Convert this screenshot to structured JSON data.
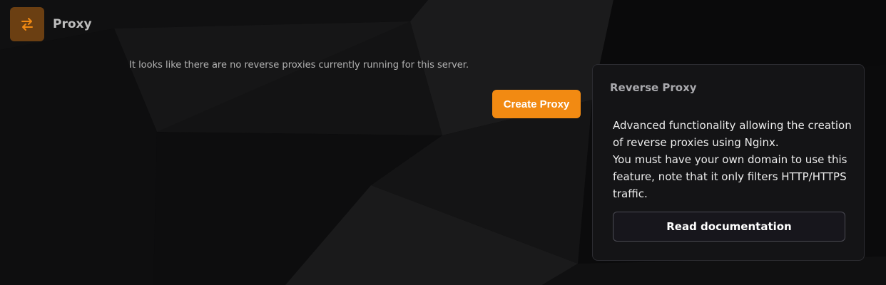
{
  "header": {
    "title": "Proxy",
    "icon": "swap-arrows-icon"
  },
  "main": {
    "empty_message": "It looks like there are no reverse proxies currently running for this server.",
    "create_button_label": "Create Proxy"
  },
  "info_card": {
    "title": "Reverse Proxy",
    "description_line1": "Advanced functionality allowing the creation of reverse proxies using Nginx.",
    "description_line2": "You must have your own domain to use this feature, note that it only filters HTTP/HTTPS traffic.",
    "button_label": "Read documentation"
  },
  "colors": {
    "accent": "#f28a12",
    "icon_bg": "#6b3f12",
    "background": "#0b0b0c",
    "card_bg": "#141416"
  }
}
